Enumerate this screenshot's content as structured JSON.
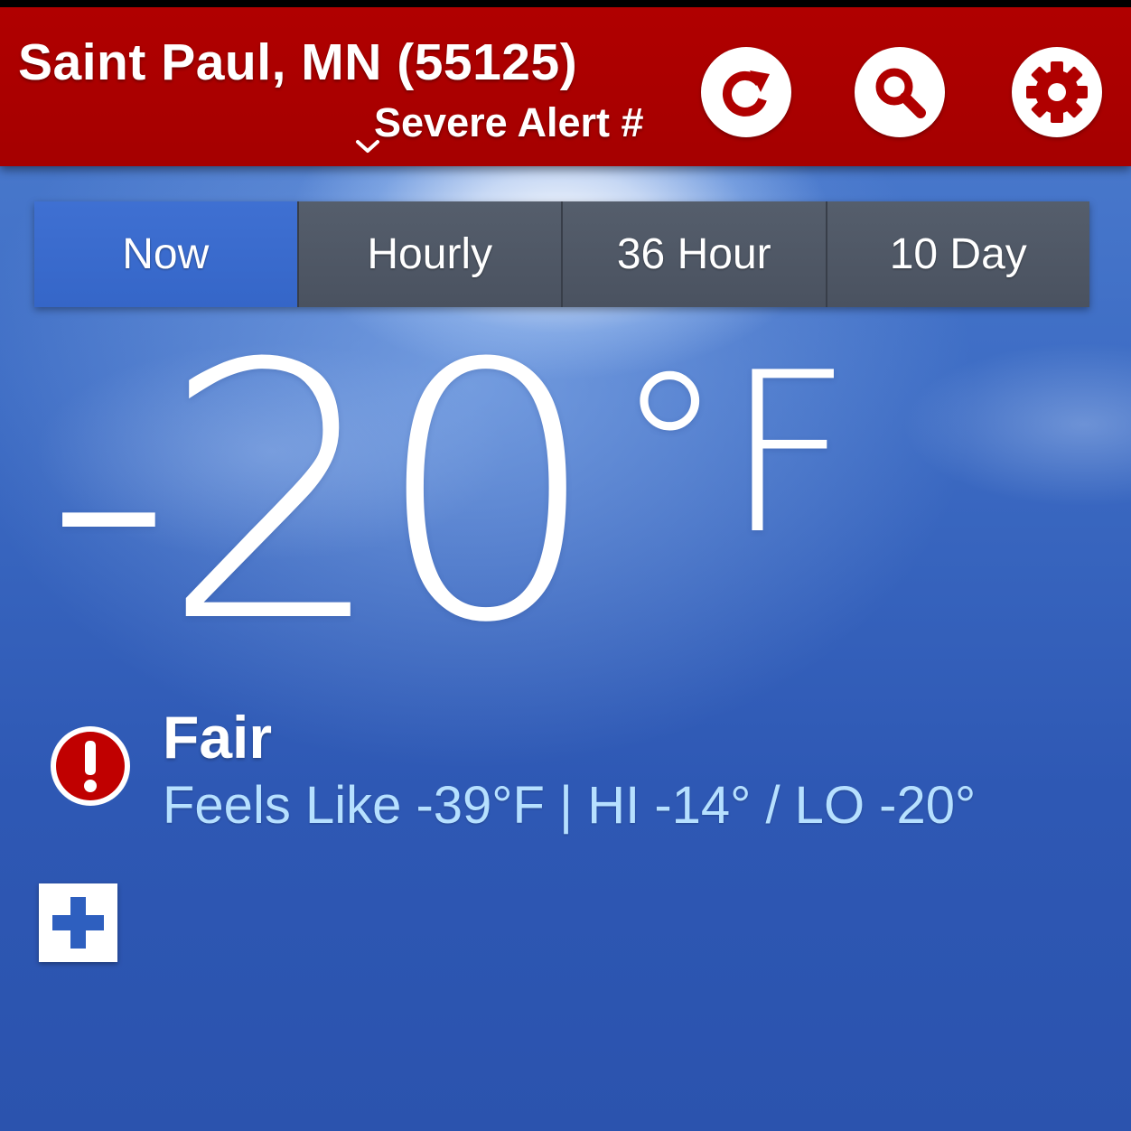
{
  "header": {
    "location": "Saint Paul, MN (55125)",
    "alert_ticker": "Severe Alert #",
    "icons": {
      "refresh": "refresh-icon",
      "search": "search-icon",
      "settings": "gear-icon",
      "alert_expand": "chevron-down-icon"
    }
  },
  "tabs": [
    {
      "label": "Now",
      "active": true
    },
    {
      "label": "Hourly",
      "active": false
    },
    {
      "label": "36 Hour",
      "active": false
    },
    {
      "label": "10 Day",
      "active": false
    }
  ],
  "current": {
    "temperature": "-20",
    "unit": "°F",
    "condition": "Fair",
    "details": "Feels Like -39°F | HI -14° / LO -20°",
    "alert_icon": "alert-exclamation-icon",
    "expand_icon": "plus-icon"
  },
  "colors": {
    "header_red": "#a50000",
    "tab_active": "#3566c8",
    "tab_inactive": "#4a5260",
    "details_text": "#b6e0ff",
    "sky_blue": "#3d6cc4"
  }
}
